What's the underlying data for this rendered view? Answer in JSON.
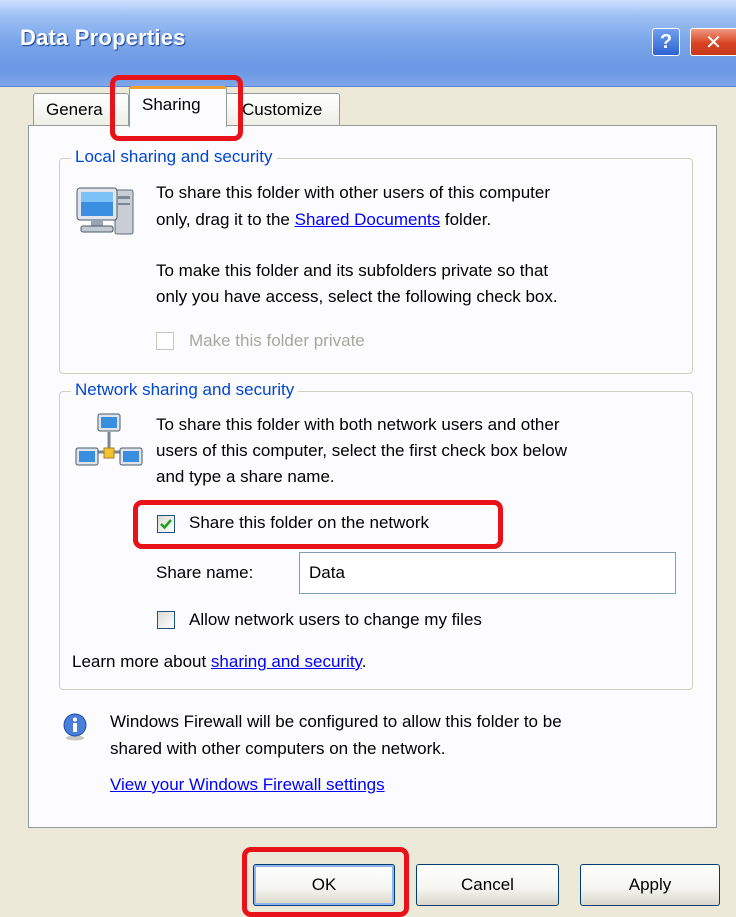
{
  "window": {
    "title": "Data Properties",
    "help_label": "?",
    "close_label": "✕"
  },
  "tabs": [
    {
      "label": "General",
      "visible_text": "Genera"
    },
    {
      "label": "Sharing",
      "visible_text": "Sharing",
      "selected": true
    },
    {
      "label": "Customize",
      "visible_text": "Customize"
    }
  ],
  "local_sharing": {
    "title": "Local sharing and security",
    "icon": "computer-icon",
    "desc_line1": "To share this folder with other users of this computer",
    "desc_line2_prefix": "only, drag it to the ",
    "desc_line2_link": "Shared Documents",
    "desc_line2_suffix": " folder.",
    "private_line1": "To make this folder and its subfolders private so that",
    "private_line2": "only you have access, select the following check box.",
    "private_checkbox_label": "Make this folder private",
    "private_checked": false,
    "private_enabled": false
  },
  "network_sharing": {
    "title": "Network sharing and security",
    "icon": "network-icon",
    "desc_line1": "To share this folder with both network users and other",
    "desc_line2": "users of this computer, select the first check box below",
    "desc_line3": "and type a share name.",
    "share_checkbox_label": "Share this folder on the network",
    "share_checked": true,
    "share_name_label": "Share name:",
    "share_name_value": "Data",
    "allow_change_label": "Allow network users to change my files",
    "allow_change_checked": false,
    "learn_more_prefix": "Learn more about ",
    "learn_more_link": "sharing and security",
    "learn_more_suffix": "."
  },
  "firewall": {
    "icon": "info-icon",
    "line1": "Windows Firewall will be configured to allow this folder to be",
    "line2": "shared with other computers on the network.",
    "link": "View your Windows Firewall settings"
  },
  "buttons": {
    "ok": "OK",
    "cancel": "Cancel",
    "apply": "Apply"
  },
  "colors": {
    "highlight": "#e8121b",
    "link": "#0000ff",
    "group_title": "#0046d5",
    "titlebar": "#6a97e3",
    "dialog_bg": "#ece9d8"
  }
}
